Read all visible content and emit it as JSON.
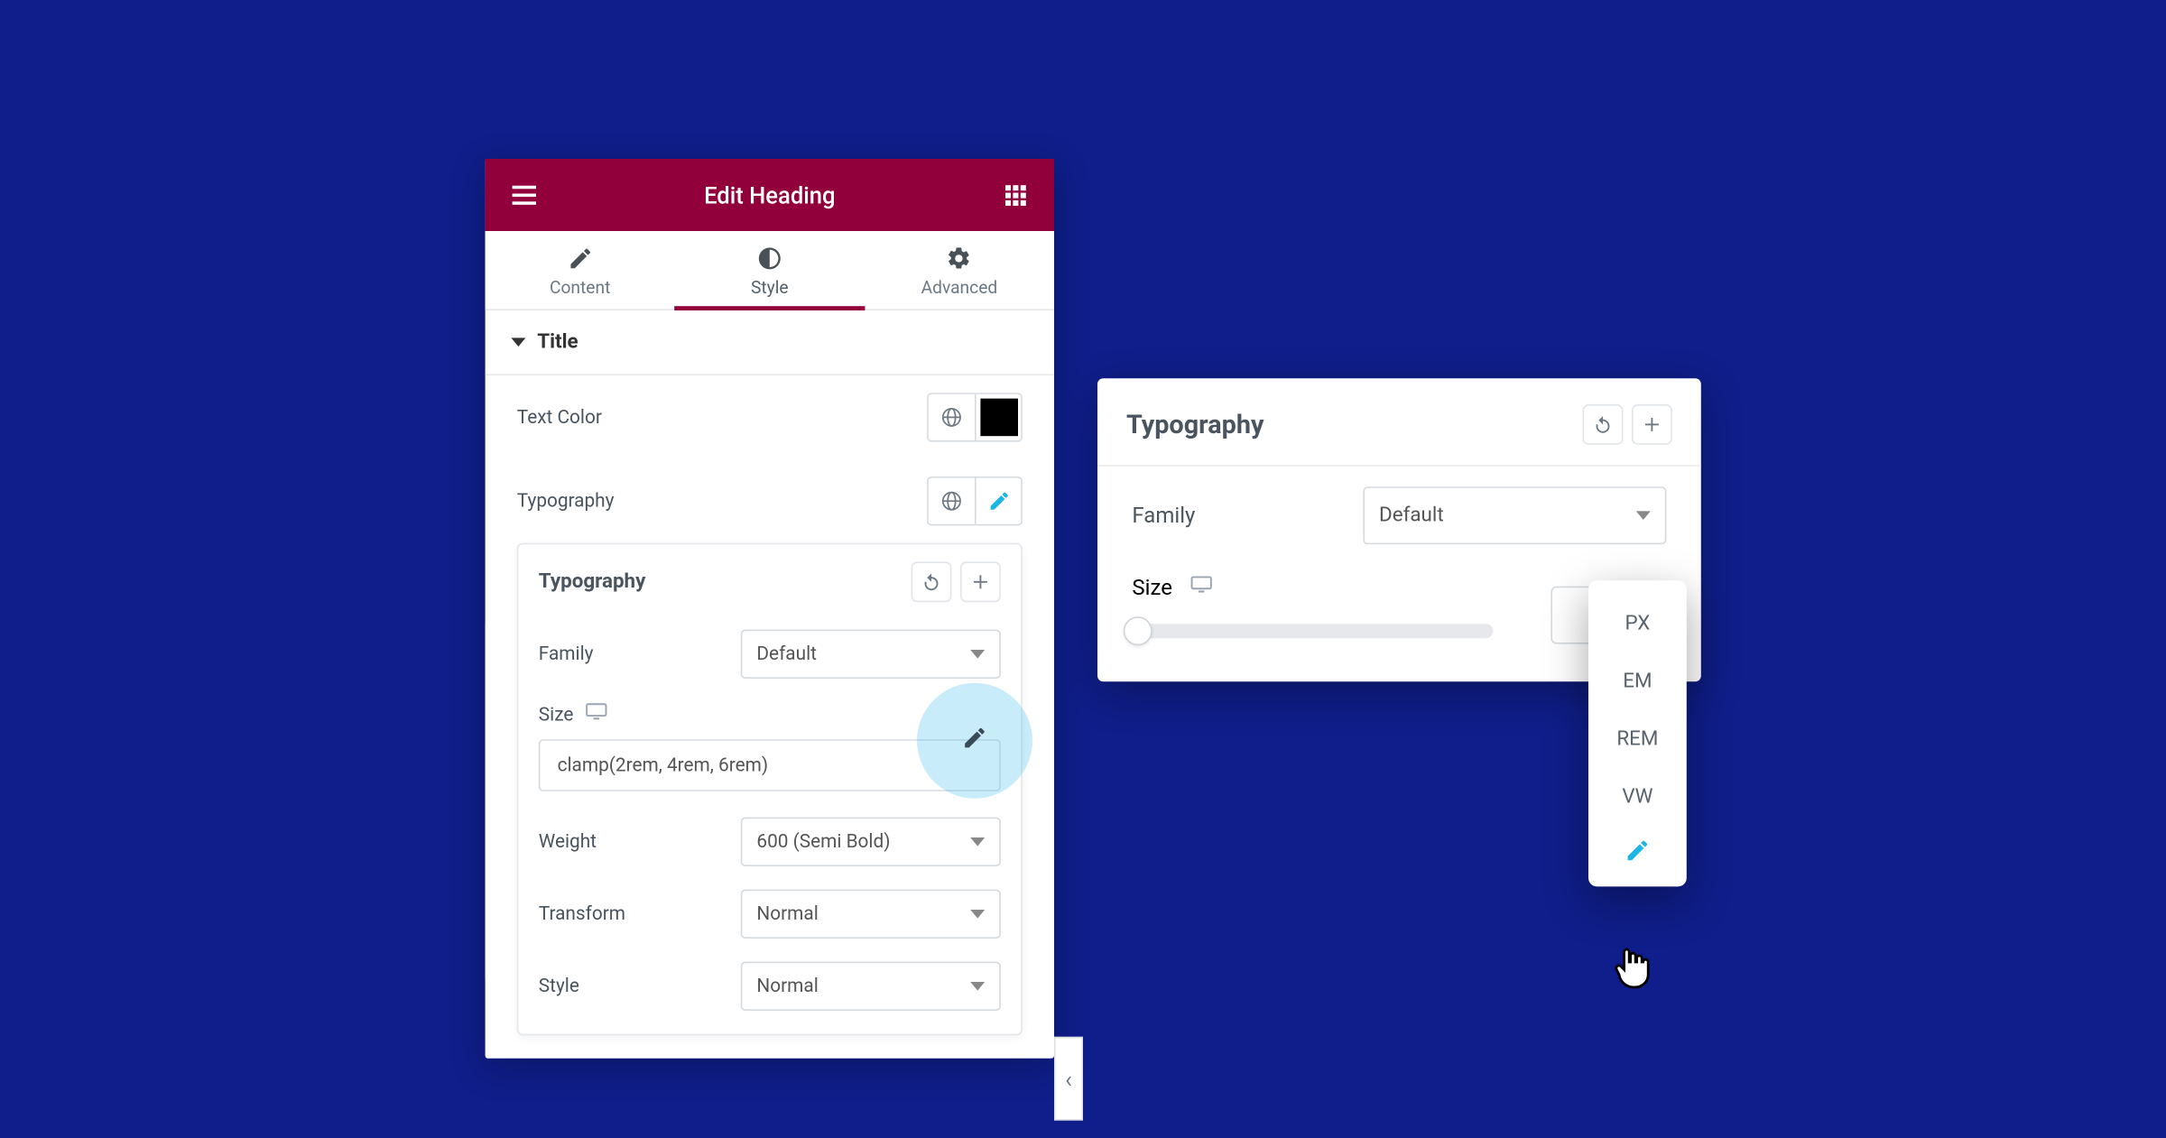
{
  "header": {
    "title": "Edit Heading"
  },
  "tabs": {
    "content": "Content",
    "style": "Style",
    "advanced": "Advanced"
  },
  "section": {
    "title": "Title"
  },
  "rows": {
    "text_color": "Text Color",
    "typography": "Typography"
  },
  "typo_card": {
    "title": "Typography",
    "family_label": "Family",
    "family_value": "Default",
    "size_label": "Size",
    "size_value": "clamp(2rem, 4rem, 6rem)",
    "weight_label": "Weight",
    "weight_value": "600 (Semi Bold)",
    "transform_label": "Transform",
    "transform_value": "Normal",
    "style_label": "Style",
    "style_value": "Normal"
  },
  "popup": {
    "title": "Typography",
    "family_label": "Family",
    "family_value": "Default",
    "size_label": "Size"
  },
  "units": {
    "px": "PX",
    "em": "EM",
    "rem": "REM",
    "vw": "VW"
  },
  "side_tab_glyph": "‹"
}
